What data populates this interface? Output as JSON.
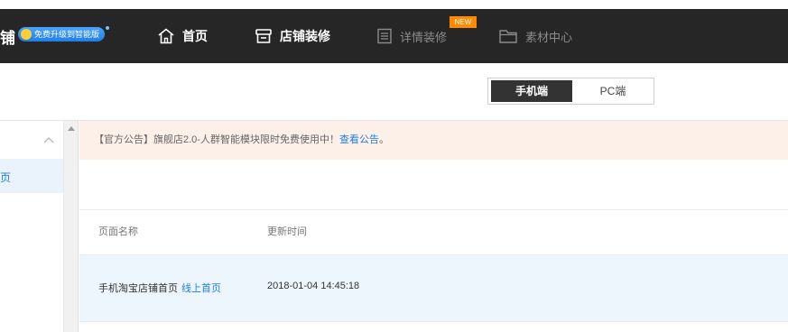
{
  "header": {
    "brand_char": "铺",
    "upgrade_badge": "免费升级到智能版",
    "nav": [
      {
        "label": "首页",
        "icon": "home-icon"
      },
      {
        "label": "店铺装修",
        "icon": "store-icon"
      },
      {
        "label": "详情装修",
        "icon": "document-icon",
        "badge": "NEW"
      },
      {
        "label": "素材中心",
        "icon": "folder-icon"
      }
    ]
  },
  "device_toggle": {
    "options": [
      "手机端",
      "PC端"
    ],
    "selected": "手机端"
  },
  "sidebar": {
    "items": [
      {
        "label": "页"
      }
    ]
  },
  "notice": {
    "text": "【官方公告】旗舰店2.0-人群智能模块限时免费使用中！",
    "link": "查看公告",
    "suffix": "。"
  },
  "table": {
    "headers": [
      "页面名称",
      "更新时间"
    ],
    "rows": [
      {
        "name": "手机淘宝店铺首页",
        "tag": "线上首页",
        "updated": "2018-01-04 14:45:18"
      }
    ]
  },
  "colors": {
    "header_bg": "#262626",
    "accent": "#1f7fe6",
    "notice_bg": "#fdf0e8",
    "row_highlight": "#eef6fd",
    "new_badge": "#ff8a00"
  }
}
